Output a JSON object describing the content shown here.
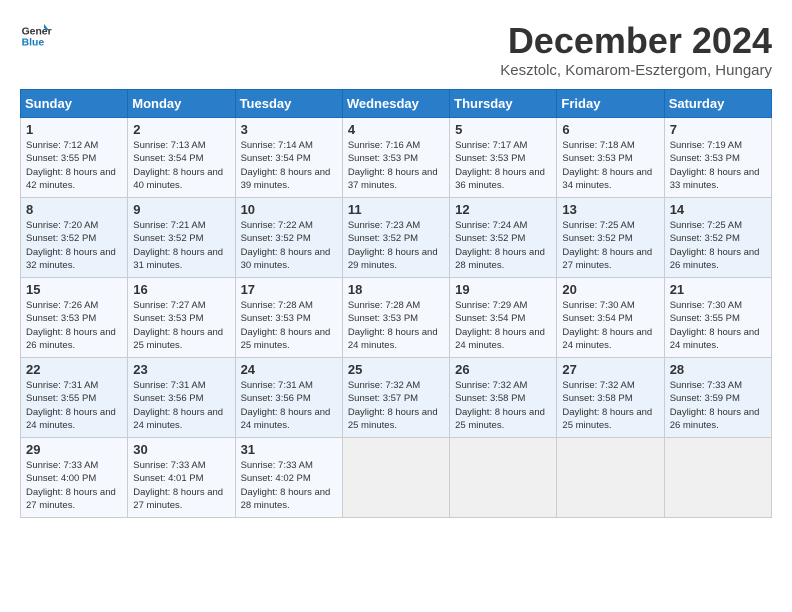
{
  "header": {
    "logo_line1": "General",
    "logo_line2": "Blue",
    "month": "December 2024",
    "location": "Kesztolc, Komarom-Esztergom, Hungary"
  },
  "weekdays": [
    "Sunday",
    "Monday",
    "Tuesday",
    "Wednesday",
    "Thursday",
    "Friday",
    "Saturday"
  ],
  "weeks": [
    [
      {
        "day": "1",
        "sunrise": "Sunrise: 7:12 AM",
        "sunset": "Sunset: 3:55 PM",
        "daylight": "Daylight: 8 hours and 42 minutes."
      },
      {
        "day": "2",
        "sunrise": "Sunrise: 7:13 AM",
        "sunset": "Sunset: 3:54 PM",
        "daylight": "Daylight: 8 hours and 40 minutes."
      },
      {
        "day": "3",
        "sunrise": "Sunrise: 7:14 AM",
        "sunset": "Sunset: 3:54 PM",
        "daylight": "Daylight: 8 hours and 39 minutes."
      },
      {
        "day": "4",
        "sunrise": "Sunrise: 7:16 AM",
        "sunset": "Sunset: 3:53 PM",
        "daylight": "Daylight: 8 hours and 37 minutes."
      },
      {
        "day": "5",
        "sunrise": "Sunrise: 7:17 AM",
        "sunset": "Sunset: 3:53 PM",
        "daylight": "Daylight: 8 hours and 36 minutes."
      },
      {
        "day": "6",
        "sunrise": "Sunrise: 7:18 AM",
        "sunset": "Sunset: 3:53 PM",
        "daylight": "Daylight: 8 hours and 34 minutes."
      },
      {
        "day": "7",
        "sunrise": "Sunrise: 7:19 AM",
        "sunset": "Sunset: 3:53 PM",
        "daylight": "Daylight: 8 hours and 33 minutes."
      }
    ],
    [
      {
        "day": "8",
        "sunrise": "Sunrise: 7:20 AM",
        "sunset": "Sunset: 3:52 PM",
        "daylight": "Daylight: 8 hours and 32 minutes."
      },
      {
        "day": "9",
        "sunrise": "Sunrise: 7:21 AM",
        "sunset": "Sunset: 3:52 PM",
        "daylight": "Daylight: 8 hours and 31 minutes."
      },
      {
        "day": "10",
        "sunrise": "Sunrise: 7:22 AM",
        "sunset": "Sunset: 3:52 PM",
        "daylight": "Daylight: 8 hours and 30 minutes."
      },
      {
        "day": "11",
        "sunrise": "Sunrise: 7:23 AM",
        "sunset": "Sunset: 3:52 PM",
        "daylight": "Daylight: 8 hours and 29 minutes."
      },
      {
        "day": "12",
        "sunrise": "Sunrise: 7:24 AM",
        "sunset": "Sunset: 3:52 PM",
        "daylight": "Daylight: 8 hours and 28 minutes."
      },
      {
        "day": "13",
        "sunrise": "Sunrise: 7:25 AM",
        "sunset": "Sunset: 3:52 PM",
        "daylight": "Daylight: 8 hours and 27 minutes."
      },
      {
        "day": "14",
        "sunrise": "Sunrise: 7:25 AM",
        "sunset": "Sunset: 3:52 PM",
        "daylight": "Daylight: 8 hours and 26 minutes."
      }
    ],
    [
      {
        "day": "15",
        "sunrise": "Sunrise: 7:26 AM",
        "sunset": "Sunset: 3:53 PM",
        "daylight": "Daylight: 8 hours and 26 minutes."
      },
      {
        "day": "16",
        "sunrise": "Sunrise: 7:27 AM",
        "sunset": "Sunset: 3:53 PM",
        "daylight": "Daylight: 8 hours and 25 minutes."
      },
      {
        "day": "17",
        "sunrise": "Sunrise: 7:28 AM",
        "sunset": "Sunset: 3:53 PM",
        "daylight": "Daylight: 8 hours and 25 minutes."
      },
      {
        "day": "18",
        "sunrise": "Sunrise: 7:28 AM",
        "sunset": "Sunset: 3:53 PM",
        "daylight": "Daylight: 8 hours and 24 minutes."
      },
      {
        "day": "19",
        "sunrise": "Sunrise: 7:29 AM",
        "sunset": "Sunset: 3:54 PM",
        "daylight": "Daylight: 8 hours and 24 minutes."
      },
      {
        "day": "20",
        "sunrise": "Sunrise: 7:30 AM",
        "sunset": "Sunset: 3:54 PM",
        "daylight": "Daylight: 8 hours and 24 minutes."
      },
      {
        "day": "21",
        "sunrise": "Sunrise: 7:30 AM",
        "sunset": "Sunset: 3:55 PM",
        "daylight": "Daylight: 8 hours and 24 minutes."
      }
    ],
    [
      {
        "day": "22",
        "sunrise": "Sunrise: 7:31 AM",
        "sunset": "Sunset: 3:55 PM",
        "daylight": "Daylight: 8 hours and 24 minutes."
      },
      {
        "day": "23",
        "sunrise": "Sunrise: 7:31 AM",
        "sunset": "Sunset: 3:56 PM",
        "daylight": "Daylight: 8 hours and 24 minutes."
      },
      {
        "day": "24",
        "sunrise": "Sunrise: 7:31 AM",
        "sunset": "Sunset: 3:56 PM",
        "daylight": "Daylight: 8 hours and 24 minutes."
      },
      {
        "day": "25",
        "sunrise": "Sunrise: 7:32 AM",
        "sunset": "Sunset: 3:57 PM",
        "daylight": "Daylight: 8 hours and 25 minutes."
      },
      {
        "day": "26",
        "sunrise": "Sunrise: 7:32 AM",
        "sunset": "Sunset: 3:58 PM",
        "daylight": "Daylight: 8 hours and 25 minutes."
      },
      {
        "day": "27",
        "sunrise": "Sunrise: 7:32 AM",
        "sunset": "Sunset: 3:58 PM",
        "daylight": "Daylight: 8 hours and 25 minutes."
      },
      {
        "day": "28",
        "sunrise": "Sunrise: 7:33 AM",
        "sunset": "Sunset: 3:59 PM",
        "daylight": "Daylight: 8 hours and 26 minutes."
      }
    ],
    [
      {
        "day": "29",
        "sunrise": "Sunrise: 7:33 AM",
        "sunset": "Sunset: 4:00 PM",
        "daylight": "Daylight: 8 hours and 27 minutes."
      },
      {
        "day": "30",
        "sunrise": "Sunrise: 7:33 AM",
        "sunset": "Sunset: 4:01 PM",
        "daylight": "Daylight: 8 hours and 27 minutes."
      },
      {
        "day": "31",
        "sunrise": "Sunrise: 7:33 AM",
        "sunset": "Sunset: 4:02 PM",
        "daylight": "Daylight: 8 hours and 28 minutes."
      },
      null,
      null,
      null,
      null
    ]
  ]
}
